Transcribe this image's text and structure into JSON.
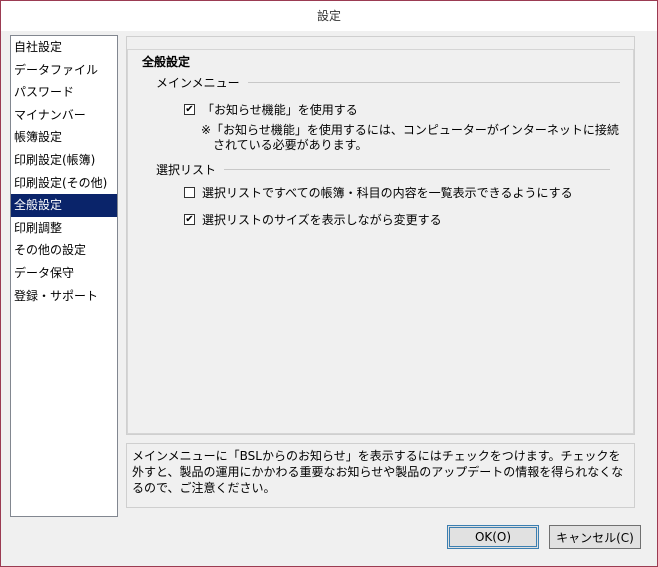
{
  "window": {
    "title": "設定"
  },
  "sidebar": {
    "items": [
      {
        "label": "自社設定"
      },
      {
        "label": "データファイル"
      },
      {
        "label": "パスワード"
      },
      {
        "label": "マイナンバー"
      },
      {
        "label": "帳簿設定"
      },
      {
        "label": "印刷設定(帳簿)"
      },
      {
        "label": "印刷設定(その他)"
      },
      {
        "label": "全般設定"
      },
      {
        "label": "印刷調整"
      },
      {
        "label": "その他の設定"
      },
      {
        "label": "データ保守"
      },
      {
        "label": "登録・サポート"
      }
    ],
    "selected": "全般設定"
  },
  "main": {
    "group_title": "全般設定",
    "menu_section": {
      "label": "メインメニュー",
      "option_label": "「お知らせ機能」を使用する",
      "option_checked": true,
      "note": "※「お知らせ機能」を使用するには、コンピューターがインターネットに接続\n　されている必要があります。"
    },
    "list_section": {
      "label": "選択リスト",
      "option1_label": "選択リストですべての帳簿・科目の内容を一覧表示できるようにする",
      "option1_checked": false,
      "option2_label": "選択リストのサイズを表示しながら変更する",
      "option2_checked": true
    }
  },
  "help_text": "メインメニューに「BSLからのお知らせ」を表示するにはチェックをつけます。チェックを外すと、製品の運用にかかわる重要なお知らせや製品のアップデートの情報を得られなくなるので、ご注意ください。",
  "buttons": {
    "ok_label": "OK(O)",
    "cancel_label": "キャンセル(C)"
  }
}
